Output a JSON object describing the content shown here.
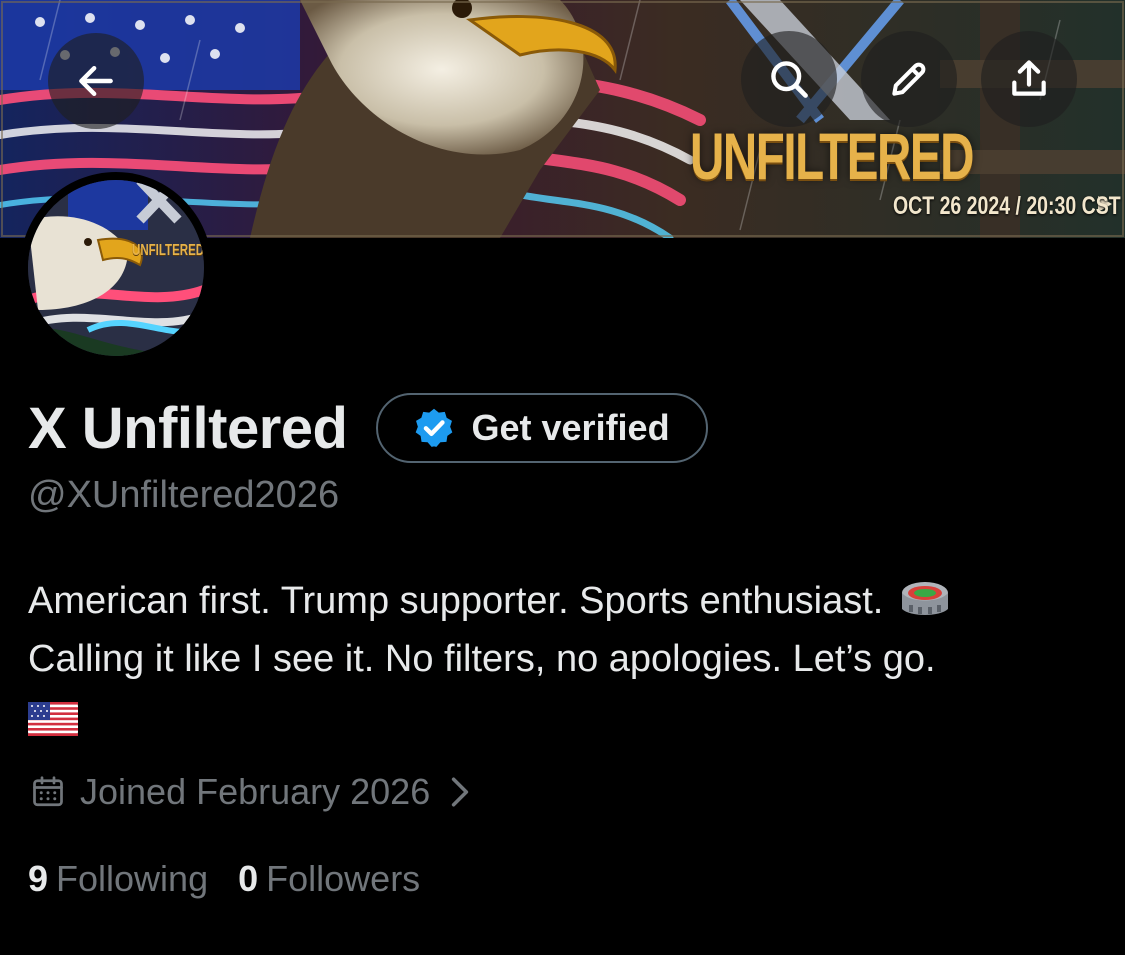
{
  "header": {
    "back_icon": "arrow-left-icon",
    "search_icon": "search-icon",
    "edit_icon": "pencil-icon",
    "share_icon": "share-upload-icon"
  },
  "banner": {
    "title": "UNFILTERED",
    "date": "OCT 26 2024 / 20:30 CST"
  },
  "avatar": {
    "text": "UNFILTERED"
  },
  "profile": {
    "display_name": "X Unfiltered",
    "verify_label": "Get verified",
    "handle": "@XUnfiltered2026",
    "bio_line1": "American first. Trump supporter. Sports enthusiast.",
    "bio_line2": "Calling it like I see it. No filters, no apologies. Let’s go.",
    "joined": "Joined February 2026",
    "following_count": "9",
    "following_label": "Following",
    "followers_count": "0",
    "followers_label": "Followers"
  },
  "colors": {
    "background": "#000000",
    "text_primary": "#e7e9ea",
    "text_secondary": "#71767b",
    "verified_blue": "#1d9bf0",
    "border": "#536471",
    "banner_gold": "#e6b24a"
  }
}
